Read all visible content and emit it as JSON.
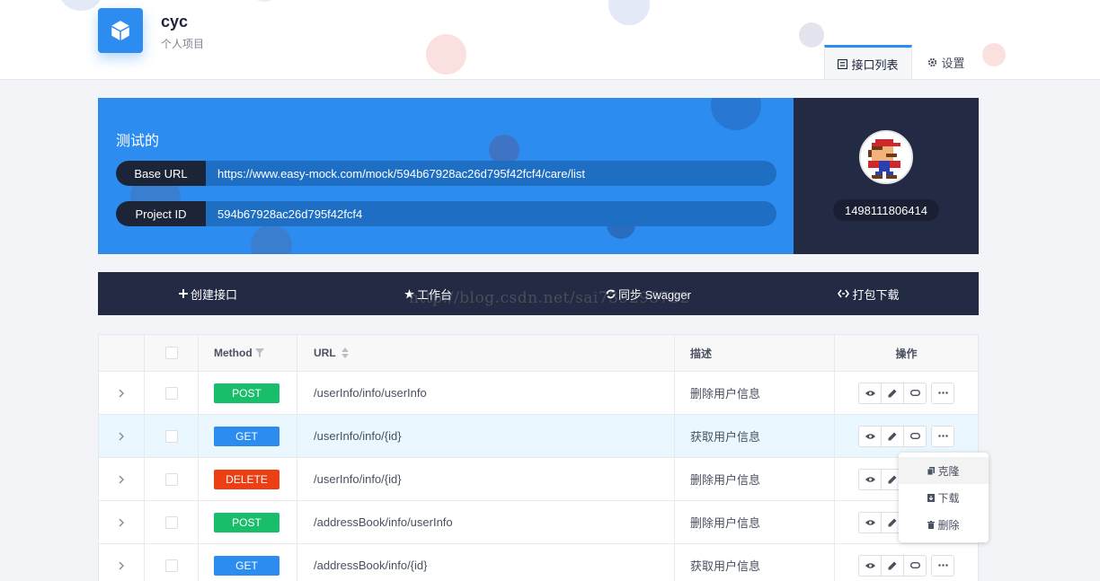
{
  "project": {
    "name": "cyc",
    "type": "个人项目"
  },
  "tabs": [
    {
      "label": "接口列表",
      "icon": "list-icon",
      "active": true
    },
    {
      "label": "设置",
      "icon": "gear-icon",
      "active": false
    }
  ],
  "info": {
    "title": "测试的",
    "base_url_label": "Base URL",
    "base_url": "https://www.easy-mock.com/mock/594b67928ac26d795f42fcf4/care/list",
    "project_id_label": "Project ID",
    "project_id": "594b67928ac26d795f42fcf4"
  },
  "user": {
    "id": "1498111806414",
    "avatar": "mario-avatar"
  },
  "toolbar": [
    {
      "label": "创建接口",
      "icon": "plus-icon"
    },
    {
      "label": "工作台",
      "icon": "star-icon"
    },
    {
      "label": "同步 Swagger",
      "icon": "sync-icon"
    },
    {
      "label": "打包下载",
      "icon": "code-icon"
    }
  ],
  "watermark": "http://blog.csdn.net/sai739295732",
  "table": {
    "headers": {
      "method": "Method",
      "url": "URL",
      "desc": "描述",
      "ops": "操作"
    },
    "rows": [
      {
        "method": "POST",
        "url": "/userInfo/info/userInfo",
        "desc": "删除用户信息"
      },
      {
        "method": "GET",
        "url": "/userInfo/info/{id}",
        "desc": "获取用户信息"
      },
      {
        "method": "DELETE",
        "url": "/userInfo/info/{id}",
        "desc": "删除用户信息"
      },
      {
        "method": "POST",
        "url": "/addressBook/info/userInfo",
        "desc": "删除用户信息"
      },
      {
        "method": "GET",
        "url": "/addressBook/info/{id}",
        "desc": "获取用户信息"
      }
    ]
  },
  "dropdown": [
    {
      "label": "克隆",
      "icon": "copy-icon"
    },
    {
      "label": "下载",
      "icon": "download-icon"
    },
    {
      "label": "删除",
      "icon": "trash-icon"
    }
  ],
  "colors": {
    "primary": "#2d8cf0",
    "dark": "#232a44",
    "post": "#19be6b",
    "get": "#2d8cf0",
    "delete": "#ed3f14"
  }
}
